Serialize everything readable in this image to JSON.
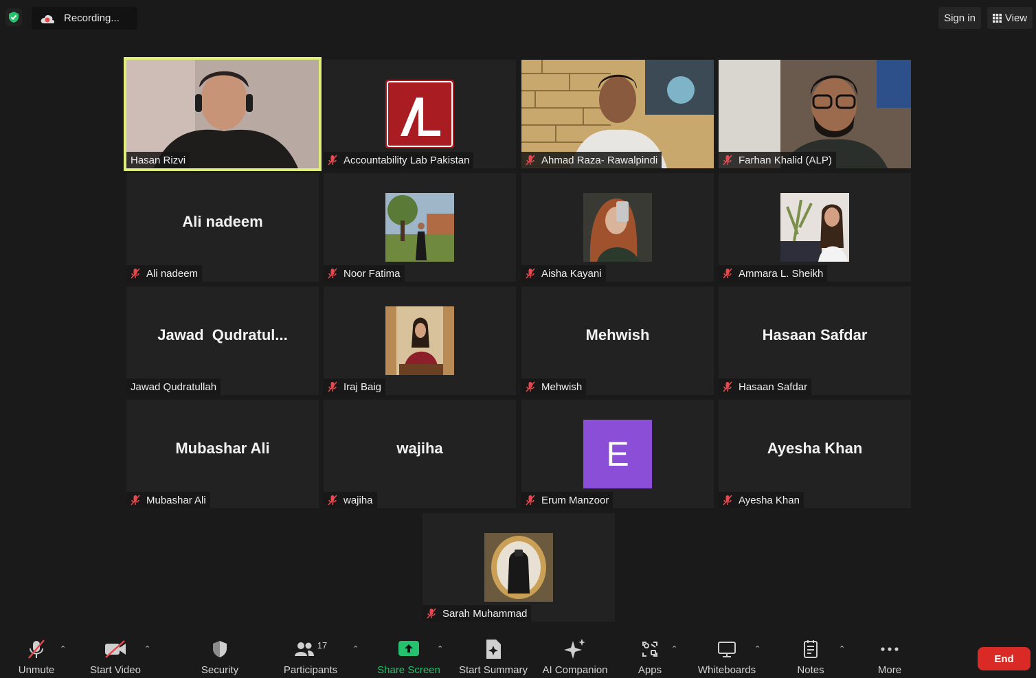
{
  "topbar": {
    "recording_label": "Recording...",
    "signin_label": "Sign in",
    "view_label": "View"
  },
  "participants": [
    {
      "display": "Hasan Rizvi",
      "label": "Hasan Rizvi",
      "muted": false,
      "kind": "video"
    },
    {
      "display": "",
      "label": "Accountability Lab Pakistan",
      "muted": true,
      "kind": "logo"
    },
    {
      "display": "",
      "label": "Ahmad Raza- Rawalpindi",
      "muted": true,
      "kind": "video"
    },
    {
      "display": "",
      "label": "Farhan Khalid (ALP)",
      "muted": true,
      "kind": "video"
    },
    {
      "display": "Ali nadeem",
      "label": "Ali nadeem",
      "muted": true,
      "kind": "name"
    },
    {
      "display": "",
      "label": "Noor Fatima",
      "muted": true,
      "kind": "photo"
    },
    {
      "display": "",
      "label": "Aisha Kayani",
      "muted": true,
      "kind": "photo"
    },
    {
      "display": "",
      "label": "Ammara L. Sheikh",
      "muted": true,
      "kind": "photo"
    },
    {
      "display": "Jawad  Qudratul...",
      "label": "Jawad Qudratullah",
      "muted": false,
      "kind": "name"
    },
    {
      "display": "",
      "label": "Iraj Baig",
      "muted": true,
      "kind": "photo"
    },
    {
      "display": "Mehwish",
      "label": "Mehwish",
      "muted": true,
      "kind": "name"
    },
    {
      "display": "Hasaan Safdar",
      "label": "Hasaan Safdar",
      "muted": true,
      "kind": "name"
    },
    {
      "display": "Mubashar Ali",
      "label": "Mubashar Ali",
      "muted": true,
      "kind": "name"
    },
    {
      "display": "wajiha",
      "label": "wajiha",
      "muted": true,
      "kind": "name"
    },
    {
      "display": "E",
      "label": "Erum Manzoor",
      "muted": true,
      "kind": "avatar"
    },
    {
      "display": "Ayesha Khan",
      "label": "Ayesha Khan",
      "muted": true,
      "kind": "name"
    },
    {
      "display": "",
      "label": "Sarah Muhammad",
      "muted": true,
      "kind": "photo"
    }
  ],
  "toolbar": {
    "unmute": "Unmute",
    "start_video": "Start Video",
    "security": "Security",
    "participants": "Participants",
    "participants_count": "17",
    "share_screen": "Share Screen",
    "start_summary": "Start Summary",
    "ai_companion": "AI Companion",
    "apps": "Apps",
    "whiteboards": "Whiteboards",
    "notes": "Notes",
    "more": "More",
    "end": "End"
  },
  "colors": {
    "background": "#1a1a1a",
    "tile": "#222222",
    "active_speaker": "#e0ee7a",
    "share_green": "#25c16f",
    "end_red": "#d92a25",
    "muted_red": "#e5484d",
    "avatar_purple": "#8a4fd6"
  }
}
